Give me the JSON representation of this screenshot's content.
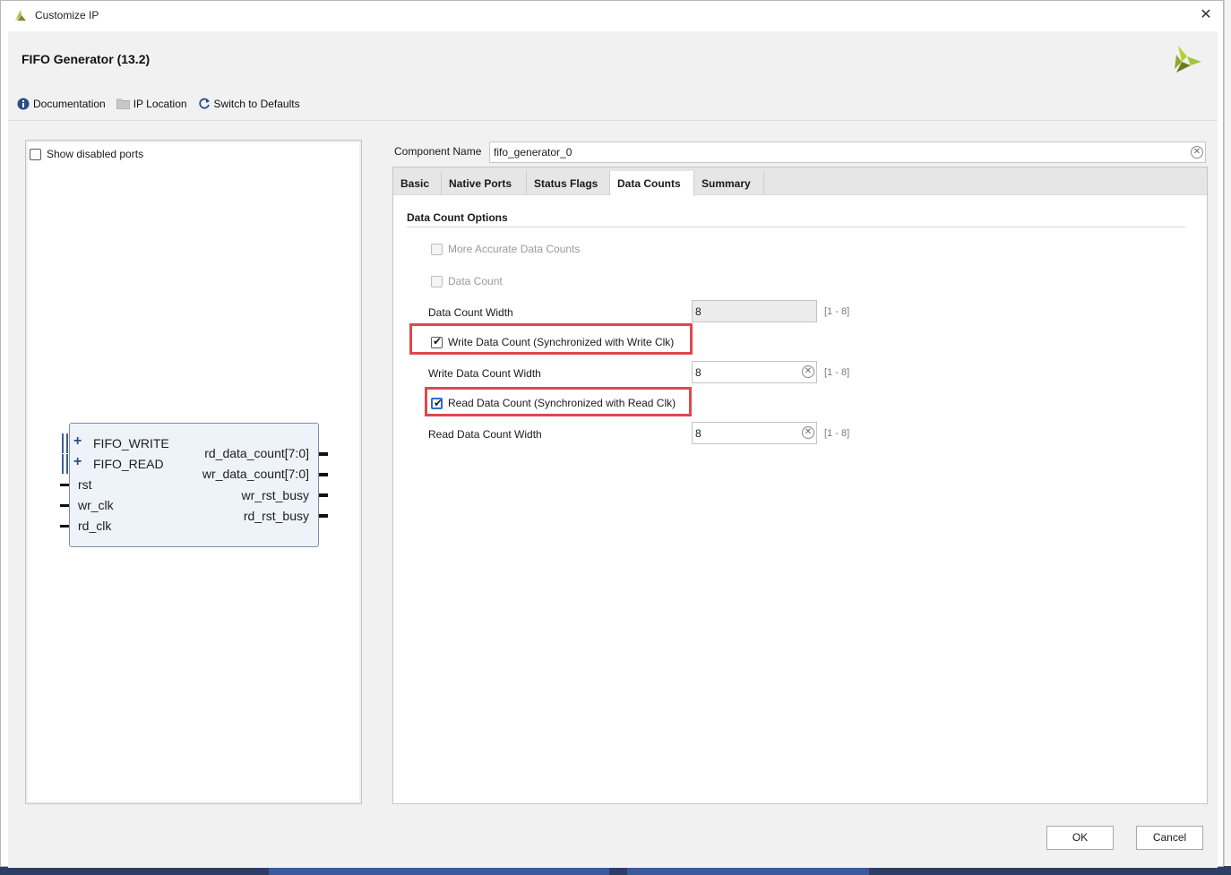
{
  "window": {
    "title": "Customize IP",
    "close_glyph": "✕"
  },
  "header": {
    "ip_name": "FIFO Generator (13.2)",
    "logo": "xilinx-logo-icon",
    "toolbar": {
      "documentation": "Documentation",
      "ip_location": "IP Location",
      "switch_defaults": "Switch to Defaults"
    }
  },
  "left_panel": {
    "show_disabled_ports": "Show disabled ports",
    "show_disabled_ports_checked": false,
    "symbol": {
      "inputs": {
        "fifo_write": "FIFO_WRITE",
        "fifo_read": "FIFO_READ",
        "rst": "rst",
        "wr_clk": "wr_clk",
        "rd_clk": "rd_clk"
      },
      "outputs": {
        "rd_data_count": "rd_data_count[7:0]",
        "wr_data_count": "wr_data_count[7:0]",
        "wr_rst_busy": "wr_rst_busy",
        "rd_rst_busy": "rd_rst_busy"
      }
    }
  },
  "component": {
    "label": "Component Name",
    "value": "fifo_generator_0"
  },
  "tabs": {
    "basic": "Basic",
    "native_ports": "Native Ports",
    "status_flags": "Status Flags",
    "data_counts": "Data Counts",
    "summary": "Summary",
    "active": "Data Counts"
  },
  "data_count_options": {
    "section_title": "Data Count Options",
    "more_accurate": "More Accurate Data Counts",
    "data_count": "Data Count",
    "data_count_width_label": "Data Count Width",
    "data_count_width_value": "8",
    "data_count_width_range": "[1 - 8]",
    "write_data_count": "Write Data Count (Synchronized with Write Clk)",
    "write_data_count_checked": true,
    "write_data_count_width_label": "Write Data Count Width",
    "write_data_count_width_value": "8",
    "write_data_count_width_range": "[1 - 8]",
    "read_data_count": "Read Data Count (Synchronized with Read Clk)",
    "read_data_count_checked": true,
    "read_data_count_width_label": "Read Data Count Width",
    "read_data_count_width_value": "8",
    "read_data_count_width_range": "[1 - 8]"
  },
  "buttons": {
    "ok": "OK",
    "cancel": "Cancel"
  },
  "colors": {
    "highlight": "#e0474c",
    "logo_green": "#a4c639",
    "logo_dark": "#6b7d1e"
  }
}
